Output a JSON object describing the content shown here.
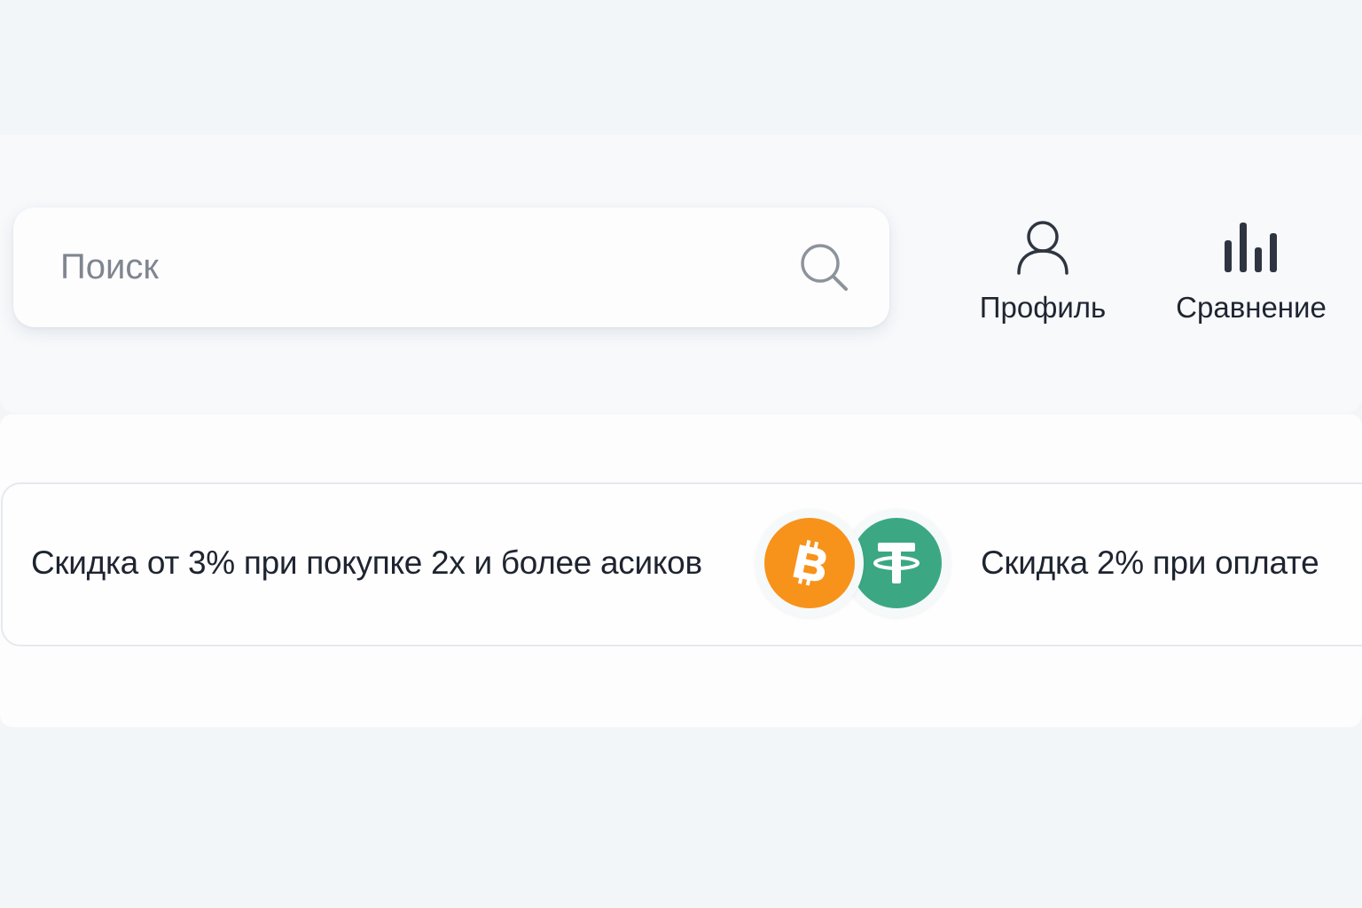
{
  "search": {
    "placeholder": "Поиск",
    "icon": "search-icon"
  },
  "nav": {
    "profile": {
      "label": "Профиль",
      "icon": "user-icon"
    },
    "compare": {
      "label": "Сравнение",
      "icon": "bar-chart-icon"
    }
  },
  "promo": {
    "left_text": "Скидка от 3% при покупке 2х и более асиков",
    "right_text": "Скидка  2% при оплате",
    "coins": [
      {
        "name": "bitcoin",
        "icon": "bitcoin-icon",
        "color": "#f7931a"
      },
      {
        "name": "tether",
        "icon": "tether-icon",
        "color": "#3ba883"
      }
    ]
  },
  "colors": {
    "page_background": "#f3f6f9",
    "text_primary": "#1e2430",
    "placeholder": "#7f8690",
    "icon": "#2f3540"
  }
}
